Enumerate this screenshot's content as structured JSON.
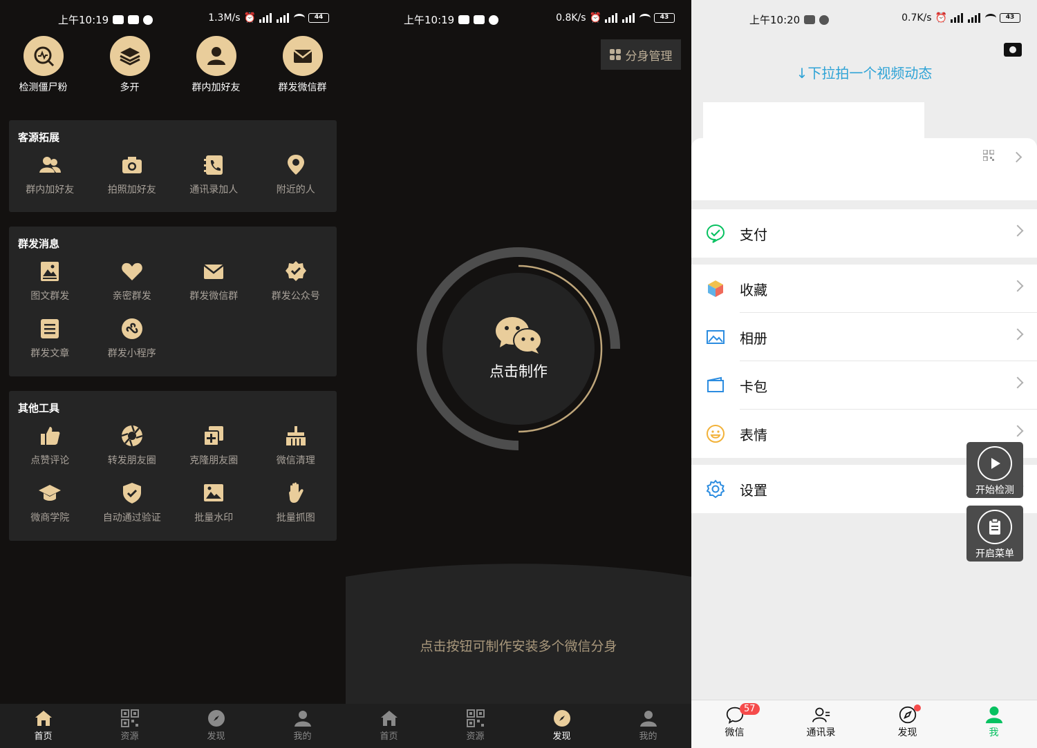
{
  "screen1": {
    "status": {
      "time": "上午10:19",
      "speed": "1.3M/s",
      "battery": "44"
    },
    "top_icons": [
      {
        "label": "检测僵尸粉",
        "icon": "detect-icon"
      },
      {
        "label": "多开",
        "icon": "layers-icon"
      },
      {
        "label": "群内加好友",
        "icon": "group-user-icon"
      },
      {
        "label": "群发微信群",
        "icon": "mail-icon"
      }
    ],
    "sections": [
      {
        "title": "客源拓展",
        "items": [
          "群内加好友",
          "拍照加好友",
          "通讯录加人",
          "附近的人"
        ]
      },
      {
        "title": "群发消息",
        "items": [
          "图文群发",
          "亲密群发",
          "群发微信群",
          "群发公众号",
          "群发文章",
          "群发小程序"
        ]
      },
      {
        "title": "其他工具",
        "items": [
          "点赞评论",
          "转发朋友圈",
          "克隆朋友圈",
          "微信清理",
          "微商学院",
          "自动通过验证",
          "批量水印",
          "批量抓图"
        ]
      }
    ],
    "tabs": [
      "首页",
      "资源",
      "发现",
      "我的"
    ]
  },
  "screen2": {
    "status": {
      "time": "上午10:19",
      "speed": "0.8K/s",
      "battery": "43"
    },
    "manage_label": "分身管理",
    "make_label": "点击制作",
    "hint": "点击按钮可制作安装多个微信分身",
    "tabs": [
      "首页",
      "资源",
      "发现",
      "我的"
    ]
  },
  "screen3": {
    "status": {
      "time": "上午10:20",
      "speed": "0.7K/s",
      "battery": "43"
    },
    "pulldown": "↓下拉拍一个视频动态",
    "menu": [
      "支付",
      "收藏",
      "相册",
      "卡包",
      "表情",
      "设置"
    ],
    "float_start": "开始检测",
    "float_menu": "开启菜单",
    "tabs": [
      "微信",
      "通讯录",
      "发现",
      "我"
    ],
    "badge": "57"
  },
  "colors": {
    "gold": "#e9cd9b",
    "wechat_green": "#07c160",
    "link_blue": "#2ea3d6"
  }
}
